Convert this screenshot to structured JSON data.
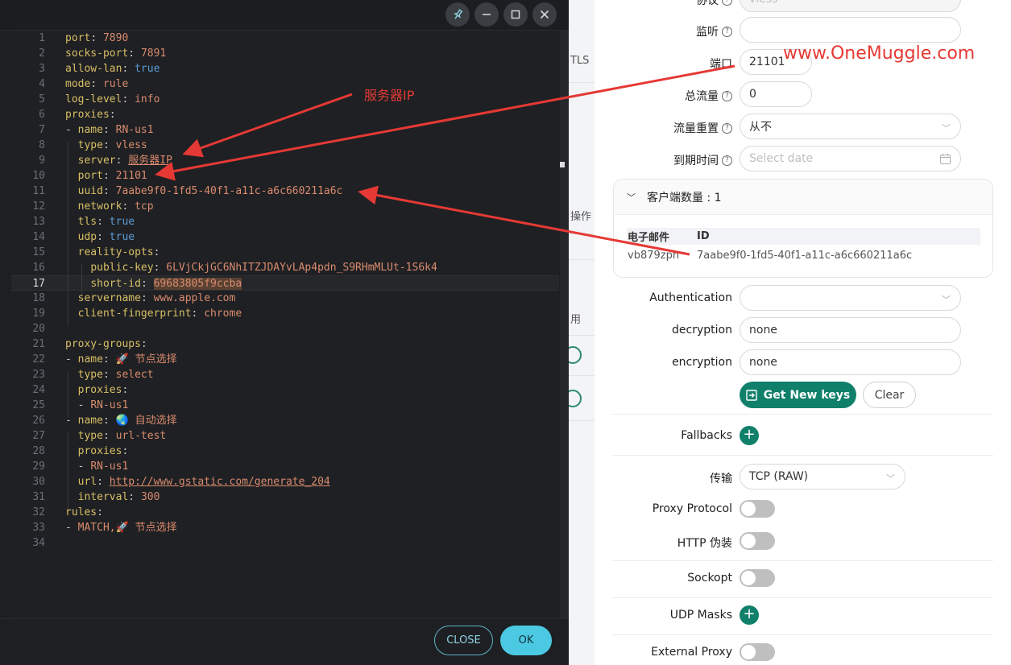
{
  "dialog": {
    "buttons": {
      "close": "CLOSE",
      "ok": "OK"
    },
    "code_lines": [
      {
        "n": "1",
        "s": [
          [
            "k",
            "port"
          ],
          [
            "p",
            ": "
          ],
          [
            "v",
            "7890"
          ]
        ]
      },
      {
        "n": "2",
        "s": [
          [
            "k",
            "socks-port"
          ],
          [
            "p",
            ": "
          ],
          [
            "v",
            "7891"
          ]
        ]
      },
      {
        "n": "3",
        "s": [
          [
            "k",
            "allow-lan"
          ],
          [
            "p",
            ": "
          ],
          [
            "b",
            "true"
          ]
        ]
      },
      {
        "n": "4",
        "s": [
          [
            "k",
            "mode"
          ],
          [
            "p",
            ": "
          ],
          [
            "v",
            "rule"
          ]
        ]
      },
      {
        "n": "5",
        "s": [
          [
            "k",
            "log-level"
          ],
          [
            "p",
            ": "
          ],
          [
            "v",
            "info"
          ]
        ]
      },
      {
        "n": "6",
        "s": [
          [
            "k",
            "proxies"
          ],
          [
            "p",
            ":"
          ]
        ]
      },
      {
        "n": "7",
        "s": [
          [
            "p",
            "- "
          ],
          [
            "k",
            "name"
          ],
          [
            "p",
            ": "
          ],
          [
            "v",
            "RN-us1"
          ]
        ]
      },
      {
        "n": "8",
        "s": [
          [
            "p",
            "  "
          ],
          [
            "k",
            "type"
          ],
          [
            "p",
            ": "
          ],
          [
            "v",
            "vless"
          ]
        ]
      },
      {
        "n": "9",
        "s": [
          [
            "p",
            "  "
          ],
          [
            "k",
            "server"
          ],
          [
            "p",
            ": "
          ],
          [
            "vu",
            "服务器IP"
          ]
        ]
      },
      {
        "n": "10",
        "s": [
          [
            "p",
            "  "
          ],
          [
            "k",
            "port"
          ],
          [
            "p",
            ": "
          ],
          [
            "v",
            "21101"
          ]
        ]
      },
      {
        "n": "11",
        "s": [
          [
            "p",
            "  "
          ],
          [
            "k",
            "uuid"
          ],
          [
            "p",
            ": "
          ],
          [
            "v",
            "7aabe9f0-1fd5-40f1-a11c-a6c660211a6c"
          ]
        ]
      },
      {
        "n": "12",
        "s": [
          [
            "p",
            "  "
          ],
          [
            "k",
            "network"
          ],
          [
            "p",
            ": "
          ],
          [
            "v",
            "tcp"
          ]
        ]
      },
      {
        "n": "13",
        "s": [
          [
            "p",
            "  "
          ],
          [
            "k",
            "tls"
          ],
          [
            "p",
            ": "
          ],
          [
            "b",
            "true"
          ]
        ]
      },
      {
        "n": "14",
        "s": [
          [
            "p",
            "  "
          ],
          [
            "k",
            "udp"
          ],
          [
            "p",
            ": "
          ],
          [
            "b",
            "true"
          ]
        ]
      },
      {
        "n": "15",
        "s": [
          [
            "p",
            "  "
          ],
          [
            "k",
            "reality-opts"
          ],
          [
            "p",
            ":"
          ]
        ]
      },
      {
        "n": "16",
        "s": [
          [
            "p",
            "    "
          ],
          [
            "k",
            "public-key"
          ],
          [
            "p",
            ": "
          ],
          [
            "v",
            "6LVjCkjGC6NhITZJDAYvLAp4pdn_S9RHmMLUt-1S6k4"
          ]
        ]
      },
      {
        "n": "17",
        "active": true,
        "s": [
          [
            "p",
            "    "
          ],
          [
            "k",
            "short-id"
          ],
          [
            "p",
            ": "
          ],
          [
            "vh",
            "69683805f9ccba"
          ]
        ]
      },
      {
        "n": "18",
        "s": [
          [
            "p",
            "  "
          ],
          [
            "k",
            "servername"
          ],
          [
            "p",
            ": "
          ],
          [
            "v",
            "www.apple.com"
          ]
        ]
      },
      {
        "n": "19",
        "s": [
          [
            "p",
            "  "
          ],
          [
            "k",
            "client-fingerprint"
          ],
          [
            "p",
            ": "
          ],
          [
            "v",
            "chrome"
          ]
        ]
      },
      {
        "n": "20",
        "s": []
      },
      {
        "n": "21",
        "s": [
          [
            "k",
            "proxy-groups"
          ],
          [
            "p",
            ":"
          ]
        ]
      },
      {
        "n": "22",
        "s": [
          [
            "p",
            "- "
          ],
          [
            "k",
            "name"
          ],
          [
            "p",
            ": "
          ],
          [
            "v",
            "🚀 节点选择"
          ]
        ]
      },
      {
        "n": "23",
        "s": [
          [
            "p",
            "  "
          ],
          [
            "k",
            "type"
          ],
          [
            "p",
            ": "
          ],
          [
            "v",
            "select"
          ]
        ]
      },
      {
        "n": "24",
        "s": [
          [
            "p",
            "  "
          ],
          [
            "k",
            "proxies"
          ],
          [
            "p",
            ":"
          ]
        ]
      },
      {
        "n": "25",
        "s": [
          [
            "p",
            "  - "
          ],
          [
            "v",
            "RN-us1"
          ]
        ]
      },
      {
        "n": "26",
        "s": [
          [
            "p",
            "- "
          ],
          [
            "k",
            "name"
          ],
          [
            "p",
            ": "
          ],
          [
            "v",
            "🌏 自动选择"
          ]
        ]
      },
      {
        "n": "27",
        "s": [
          [
            "p",
            "  "
          ],
          [
            "k",
            "type"
          ],
          [
            "p",
            ": "
          ],
          [
            "v",
            "url-test"
          ]
        ]
      },
      {
        "n": "28",
        "s": [
          [
            "p",
            "  "
          ],
          [
            "k",
            "proxies"
          ],
          [
            "p",
            ":"
          ]
        ]
      },
      {
        "n": "29",
        "s": [
          [
            "p",
            "  - "
          ],
          [
            "v",
            "RN-us1"
          ]
        ]
      },
      {
        "n": "30",
        "s": [
          [
            "p",
            "  "
          ],
          [
            "k",
            "url"
          ],
          [
            "p",
            ": "
          ],
          [
            "vu",
            "http://www.gstatic.com/generate_204"
          ]
        ]
      },
      {
        "n": "31",
        "s": [
          [
            "p",
            "  "
          ],
          [
            "k",
            "interval"
          ],
          [
            "p",
            ": "
          ],
          [
            "v",
            "300"
          ]
        ]
      },
      {
        "n": "32",
        "s": [
          [
            "k",
            "rules"
          ],
          [
            "p",
            ":"
          ]
        ]
      },
      {
        "n": "33",
        "s": [
          [
            "p",
            "- "
          ],
          [
            "v",
            "MATCH,🚀 节点选择"
          ]
        ]
      },
      {
        "n": "34",
        "s": []
      }
    ],
    "window_icons": [
      "pin-icon",
      "minimize-icon",
      "maximize-icon",
      "close-icon"
    ]
  },
  "background_fragments": {
    "tls": "TLS",
    "actions": "操作",
    "enable": "用"
  },
  "panel": {
    "protocol": {
      "label": "协议",
      "value": "vless"
    },
    "listen": {
      "label": "监听",
      "value": ""
    },
    "port": {
      "label": "端口",
      "value": "21101"
    },
    "total_traffic": {
      "label": "总流量",
      "value": "0"
    },
    "traffic_reset": {
      "label": "流量重置",
      "value": "从不"
    },
    "expiry": {
      "label": "到期时间",
      "placeholder": "Select date"
    },
    "clients": {
      "header": "客户端数量 : 1",
      "col_email": "电子邮件",
      "col_id": "ID",
      "rows": [
        {
          "email": "vb879zph",
          "id": "7aabe9f0-1fd5-40f1-a11c-a6c660211a6c"
        }
      ]
    },
    "authentication": {
      "label": "Authentication",
      "value": ""
    },
    "decryption": {
      "label": "decryption",
      "value": "none"
    },
    "encryption": {
      "label": "encryption",
      "value": "none"
    },
    "get_new_keys": "Get New keys",
    "clear": "Clear",
    "fallbacks": {
      "label": "Fallbacks"
    },
    "transport": {
      "label": "传输",
      "value": "TCP (RAW)"
    },
    "proxy_protocol": {
      "label": "Proxy Protocol",
      "on": false
    },
    "http_camouflage": {
      "label": "HTTP 伪装",
      "on": false
    },
    "sockopt": {
      "label": "Sockopt",
      "on": false
    },
    "udp_masks": {
      "label": "UDP Masks"
    },
    "external_proxy": {
      "label": "External Proxy",
      "on": false
    }
  },
  "annotations": {
    "server_ip": "服务器IP",
    "watermark": "www.OneMuggle.com",
    "color": "#e53935"
  },
  "colors": {
    "primary": "#10806a",
    "dialog_bg": "#1e1f22",
    "ok": "#4cc9e2",
    "yaml_key": "#d8bf66",
    "yaml_value": "#d98b6e",
    "yaml_bool": "#5a9bd6"
  }
}
